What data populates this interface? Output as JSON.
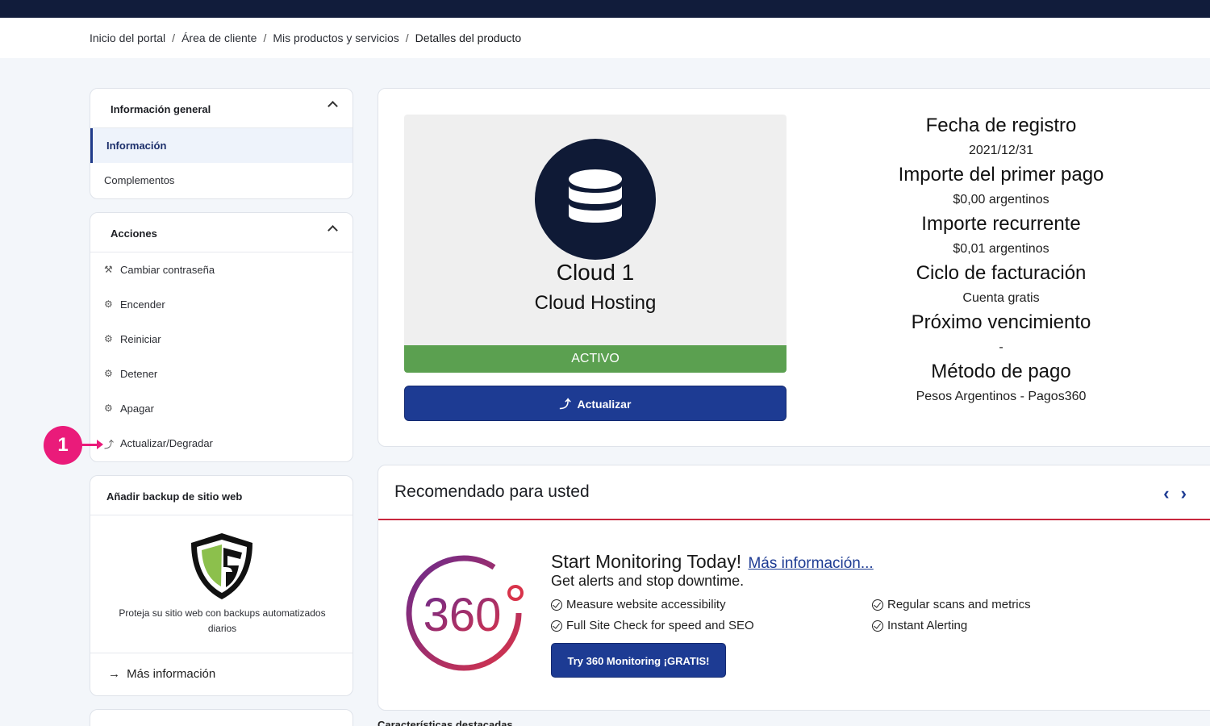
{
  "breadcrumb": [
    "Inicio del portal",
    "Área de cliente",
    "Mis productos y servicios",
    "Detalles del producto"
  ],
  "breadcrumb_separator": "/",
  "sidebar": {
    "general": {
      "title": "Información general",
      "items": [
        {
          "label": "Información",
          "active": true
        },
        {
          "label": "Complementos",
          "active": false
        }
      ]
    },
    "actions": {
      "title": "Acciones",
      "items": [
        {
          "label": "Cambiar contraseña",
          "icon": "key-icon"
        },
        {
          "label": "Encender",
          "icon": "gears-icon"
        },
        {
          "label": "Reiniciar",
          "icon": "gears-icon"
        },
        {
          "label": "Detener",
          "icon": "gears-icon"
        },
        {
          "label": "Apagar",
          "icon": "gears-icon"
        },
        {
          "label": "Actualizar/Degradar",
          "icon": "level-up-icon"
        }
      ]
    },
    "backup": {
      "title": "Añadir backup de sitio web",
      "description": "Proteja su sitio web con backups automatizados diarios",
      "link": "Más información"
    },
    "annotation": "1"
  },
  "product": {
    "name": "Cloud 1",
    "group": "Cloud Hosting",
    "status": "ACTIVO",
    "upgrade_button": "Actualizar",
    "icon": "database-icon"
  },
  "details": [
    {
      "label": "Fecha de registro",
      "value": "2021/12/31"
    },
    {
      "label": "Importe del primer pago",
      "value": "$0,00 argentinos"
    },
    {
      "label": "Importe recurrente",
      "value": "$0,01 argentinos"
    },
    {
      "label": "Ciclo de facturación",
      "value": "Cuenta gratis"
    },
    {
      "label": "Próximo vencimiento",
      "value": "-"
    },
    {
      "label": "Método de pago",
      "value": "Pesos Argentinos - Pagos360"
    }
  ],
  "recommended": {
    "title": "Recomendado para usted",
    "headline": "Start Monitoring Today!",
    "more_link": "Más información...",
    "subhead": "Get alerts and stop downtime.",
    "features": [
      "Measure website accessibility",
      "Full Site Check for speed and SEO",
      "Regular scans and metrics",
      "Instant Alerting"
    ],
    "cta": "Try 360 Monitoring ¡GRATIS!",
    "logo_text": "360"
  },
  "footer_heading": "Características destacadas",
  "colors": {
    "accent": "#1d3b93",
    "topbar": "#111c3b",
    "active": "#5ba050",
    "annotation": "#ea1b7a",
    "divider": "#c8283e"
  }
}
